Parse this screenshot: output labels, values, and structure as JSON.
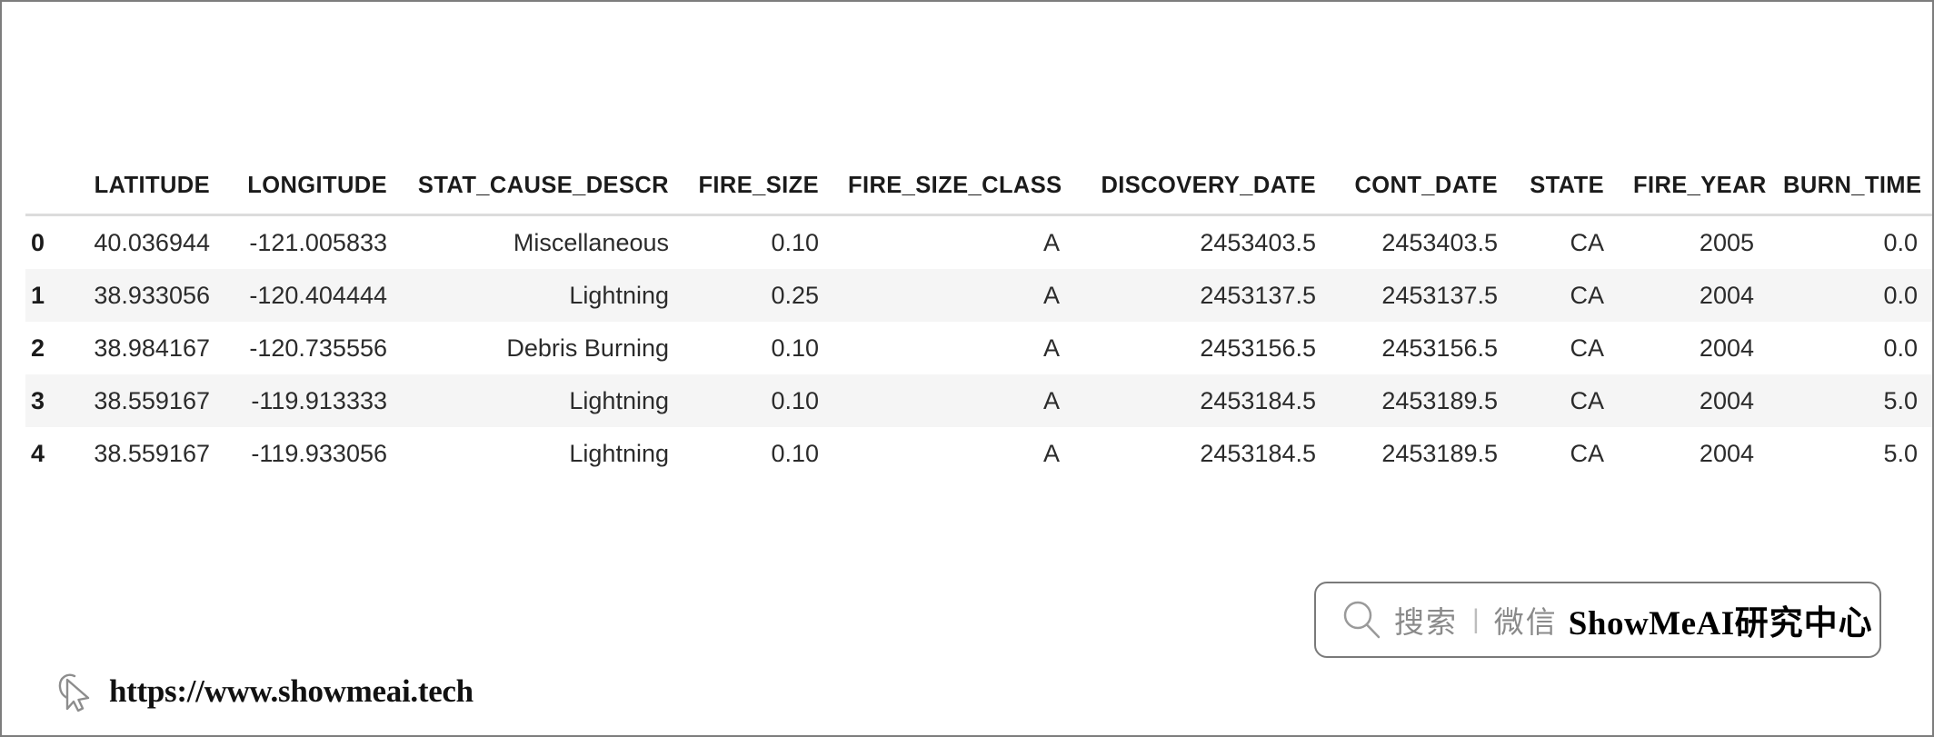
{
  "table": {
    "index_header": "",
    "columns": [
      "LATITUDE",
      "LONGITUDE",
      "STAT_CAUSE_DESCR",
      "FIRE_SIZE",
      "FIRE_SIZE_CLASS",
      "DISCOVERY_DATE",
      "CONT_DATE",
      "STATE",
      "FIRE_YEAR",
      "BURN_TIME"
    ],
    "rows": [
      {
        "index": "0",
        "LATITUDE": "40.036944",
        "LONGITUDE": "-121.005833",
        "STAT_CAUSE_DESCR": "Miscellaneous",
        "FIRE_SIZE": "0.10",
        "FIRE_SIZE_CLASS": "A",
        "DISCOVERY_DATE": "2453403.5",
        "CONT_DATE": "2453403.5",
        "STATE": "CA",
        "FIRE_YEAR": "2005",
        "BURN_TIME": "0.0"
      },
      {
        "index": "1",
        "LATITUDE": "38.933056",
        "LONGITUDE": "-120.404444",
        "STAT_CAUSE_DESCR": "Lightning",
        "FIRE_SIZE": "0.25",
        "FIRE_SIZE_CLASS": "A",
        "DISCOVERY_DATE": "2453137.5",
        "CONT_DATE": "2453137.5",
        "STATE": "CA",
        "FIRE_YEAR": "2004",
        "BURN_TIME": "0.0"
      },
      {
        "index": "2",
        "LATITUDE": "38.984167",
        "LONGITUDE": "-120.735556",
        "STAT_CAUSE_DESCR": "Debris Burning",
        "FIRE_SIZE": "0.10",
        "FIRE_SIZE_CLASS": "A",
        "DISCOVERY_DATE": "2453156.5",
        "CONT_DATE": "2453156.5",
        "STATE": "CA",
        "FIRE_YEAR": "2004",
        "BURN_TIME": "0.0"
      },
      {
        "index": "3",
        "LATITUDE": "38.559167",
        "LONGITUDE": "-119.913333",
        "STAT_CAUSE_DESCR": "Lightning",
        "FIRE_SIZE": "0.10",
        "FIRE_SIZE_CLASS": "A",
        "DISCOVERY_DATE": "2453184.5",
        "CONT_DATE": "2453189.5",
        "STATE": "CA",
        "FIRE_YEAR": "2004",
        "BURN_TIME": "5.0"
      },
      {
        "index": "4",
        "LATITUDE": "38.559167",
        "LONGITUDE": "-119.933056",
        "STAT_CAUSE_DESCR": "Lightning",
        "FIRE_SIZE": "0.10",
        "FIRE_SIZE_CLASS": "A",
        "DISCOVERY_DATE": "2453184.5",
        "CONT_DATE": "2453189.5",
        "STATE": "CA",
        "FIRE_YEAR": "2004",
        "BURN_TIME": "5.0"
      }
    ]
  },
  "watermark": {
    "search_label": "搜索",
    "separator": "|",
    "channel_label": "微信",
    "brand_en": "ShowMeAI",
    "brand_cn": "研究中心",
    "search_icon": "search-icon"
  },
  "footer": {
    "cursor_icon": "cursor-arrow-icon",
    "url": "https://www.showmeai.tech"
  },
  "colors": {
    "page_background": "#ffffff",
    "page_border": "#7d7d7d",
    "header_text": "#1b1b1b",
    "cell_text": "#2b2b2b",
    "header_rule": "#dcdcdc",
    "stripe": "#f5f5f5",
    "watermark_border": "#7a7a7a",
    "watermark_muted_text": "#8a8a8a"
  }
}
